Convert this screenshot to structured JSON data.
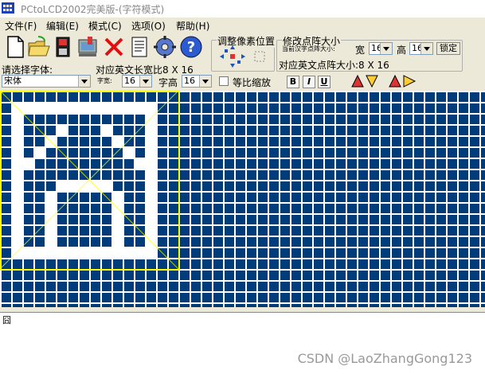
{
  "window": {
    "title": "PCtoLCD2002完美版-(字符模式)"
  },
  "menu": [
    {
      "label": "文件(F)"
    },
    {
      "label": "编辑(E)"
    },
    {
      "label": "模式(C)"
    },
    {
      "label": "选项(O)"
    },
    {
      "label": "帮助(H)"
    }
  ],
  "toolbar": {
    "icons": [
      "new-file-icon",
      "open-folder-icon",
      "save-icon",
      "download-icon",
      "delete-icon",
      "document-icon",
      "gear-icon",
      "help-icon"
    ],
    "adjust_title": "调整像素位置",
    "resize_title": "修改点阵大小",
    "current_font_size_label": "当前汉字点阵大小:",
    "width_label": "宽",
    "height_label": "高",
    "width_value": "16",
    "height_value": "16",
    "lock_label": "锁定",
    "ascii_size_text": "对应英文点阵大小:8 X 16",
    "ascii_size_text2": "对应英文长宽比8 X 16",
    "font_select_label": "请选择字体:",
    "font_value": "宋体",
    "char_width_label": "字宽:",
    "char_width_value": "16",
    "char_height_label": "字高",
    "char_height_value": "16",
    "proportional_label": "等比缩放",
    "bold_label": "B",
    "italic_label": "I",
    "underline_label": "U"
  },
  "colors": {
    "background": "#003b7a",
    "grid": "#ffffff",
    "pixel_on": "#ffffff",
    "selection": "#ffff00",
    "pixel_off": "#0a3b78"
  },
  "status": {
    "char": "囧"
  },
  "watermark": "CSDN @LaoZhangGong123"
}
